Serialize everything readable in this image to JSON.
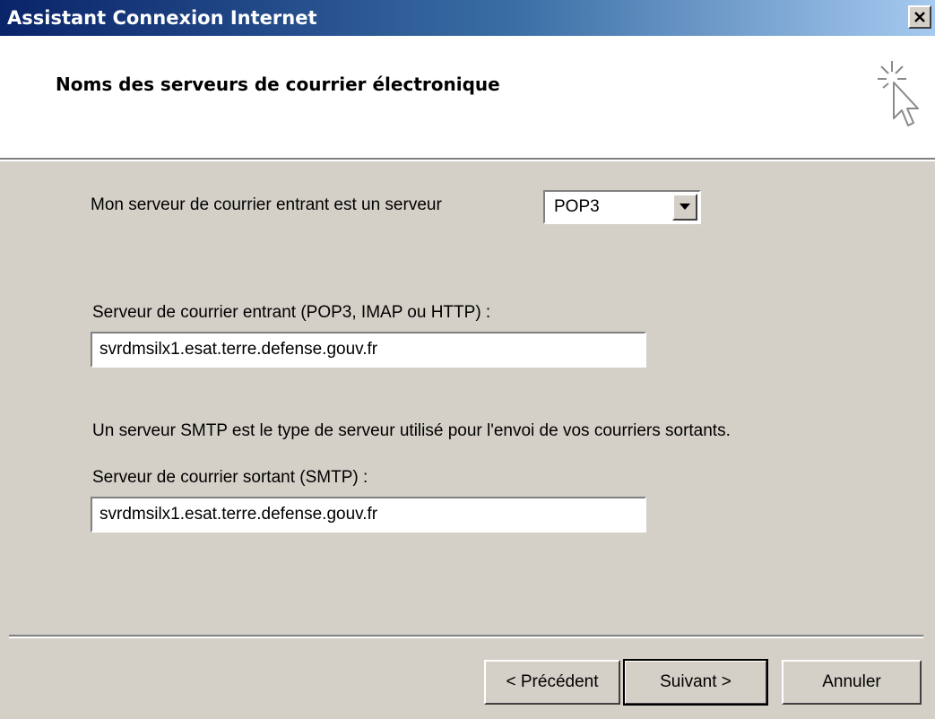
{
  "window": {
    "title": "Assistant Connexion Internet",
    "close_label": "close"
  },
  "header": {
    "title": "Noms des serveurs de courrier électronique",
    "icon": "wizard-cursor-icon"
  },
  "form": {
    "incoming_type_label": "Mon serveur de courrier entrant est un serveur",
    "incoming_type_value": "POP3",
    "incoming_server_label": "Serveur de courrier entrant (POP3, IMAP ou HTTP) :",
    "incoming_server_value": "svrdmsilx1.esat.terre.defense.gouv.fr",
    "smtp_info": "Un serveur SMTP est le type de serveur utilisé pour l'envoi de vos courriers sortants.",
    "outgoing_server_label": "Serveur de courrier sortant (SMTP) :",
    "outgoing_server_value": "svrdmsilx1.esat.terre.defense.gouv.fr"
  },
  "buttons": {
    "back": "< Précédent",
    "next": "Suivant >",
    "cancel": "Annuler"
  },
  "colors": {
    "title_gradient_start": "#0a246a",
    "title_gradient_end": "#a6caf0",
    "face": "#d4d0c8"
  }
}
